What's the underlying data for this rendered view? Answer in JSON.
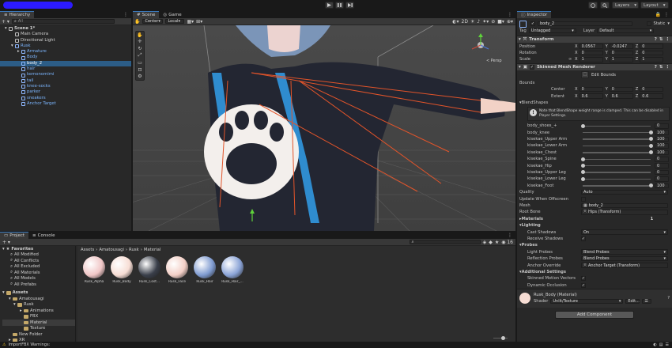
{
  "toolbar": {
    "layers_label": "Layers",
    "layout_label": "Layout"
  },
  "hierarchy": {
    "tab_label": "Hierarchy",
    "search_placeholder": "All",
    "items": [
      {
        "label": "Scene 1*",
        "selected": false
      },
      {
        "label": "Main Camera",
        "selected": false
      },
      {
        "label": "Directional Light",
        "selected": false
      },
      {
        "label": "Rusk",
        "selected": false
      },
      {
        "label": "Armature",
        "selected": false
      },
      {
        "label": "Body",
        "selected": false
      },
      {
        "label": "body_2",
        "selected": true
      },
      {
        "label": "hair",
        "selected": false
      },
      {
        "label": "kemonomimi",
        "selected": false
      },
      {
        "label": "tail",
        "selected": false
      },
      {
        "label": "knee-socks",
        "selected": false
      },
      {
        "label": "parker",
        "selected": false
      },
      {
        "label": "sneakers",
        "selected": false
      },
      {
        "label": "Anchor Target",
        "selected": false
      }
    ]
  },
  "scene": {
    "tabs": [
      {
        "label": "Scene"
      },
      {
        "label": "Game"
      }
    ],
    "center_label": "Center",
    "local_label": "Local",
    "persp_label": "< Persp"
  },
  "inspector": {
    "tab_label": "Inspector",
    "object_name": "body_2",
    "static_label": "Static",
    "tag_label": "Tag",
    "tag_value": "Untagged",
    "layer_label": "Layer",
    "layer_value": "Default",
    "transform": {
      "title": "Transform",
      "position_label": "Position",
      "rotation_label": "Rotation",
      "scale_label": "Scale",
      "position": {
        "x": "0.0567",
        "y": "-0.0247",
        "z": "0"
      },
      "rotation": {
        "x": "0",
        "y": "0",
        "z": "0"
      },
      "scale": {
        "x": "1",
        "y": "1",
        "z": "1"
      }
    },
    "smr": {
      "title": "Skinned Mesh Renderer",
      "edit_bounds": "Edit Bounds",
      "bounds_label": "Bounds",
      "center_label": "Center",
      "extent_label": "Extent",
      "center": {
        "x": "0",
        "y": "0",
        "z": "0"
      },
      "extent": {
        "x": "0.6",
        "y": "0.6",
        "z": "0.6"
      },
      "blendshapes_label": "BlendShapes",
      "note": "Note that BlendShape weight range is clamped. This can be disabled in Player Settings.",
      "blendshapes": [
        {
          "name": "body_shoes_+",
          "value": "0",
          "fraction": 0.0
        },
        {
          "name": "body_knee",
          "value": "100",
          "fraction": 1.0
        },
        {
          "name": "kisekae_Upper Arm",
          "value": "100",
          "fraction": 1.0
        },
        {
          "name": "kisekae_Lower Arm",
          "value": "100",
          "fraction": 1.0
        },
        {
          "name": "kisekae_Chest",
          "value": "100",
          "fraction": 1.0
        },
        {
          "name": "kisekae_Spine",
          "value": "0",
          "fraction": 0.0
        },
        {
          "name": "kisekae_Hip",
          "value": "0",
          "fraction": 0.0
        },
        {
          "name": "kisekae_Upper Leg",
          "value": "0",
          "fraction": 0.0
        },
        {
          "name": "kisekae_Lower Leg",
          "value": "0",
          "fraction": 0.0
        },
        {
          "name": "kisekae_Foot",
          "value": "100",
          "fraction": 1.0
        }
      ],
      "quality_label": "Quality",
      "quality_value": "Auto",
      "update_offscreen_label": "Update When Offscreen",
      "mesh_label": "Mesh",
      "mesh_value": "body_2",
      "root_bone_label": "Root Bone",
      "root_bone_value": "Hips (Transform)",
      "materials_label": "Materials",
      "materials_count": "1",
      "lighting_label": "Lighting",
      "cast_shadows_label": "Cast Shadows",
      "cast_shadows_value": "On",
      "receive_shadows_label": "Receive Shadows",
      "probes_label": "Probes",
      "light_probes_label": "Light Probes",
      "light_probes_value": "Blend Probes",
      "reflection_probes_label": "Reflection Probes",
      "reflection_probes_value": "Blend Probes",
      "anchor_override_label": "Anchor Override",
      "anchor_override_value": "Anchor Target (Transform)",
      "additional_label": "Additional Settings",
      "skinned_motion_label": "Skinned Motion Vectors",
      "dynamic_occlusion_label": "Dynamic Occlusion"
    },
    "material": {
      "name": "Rusk_Body (Material)",
      "shader_label": "Shader",
      "shader_value": "Unlit/Texture",
      "edit_label": "Edit..."
    },
    "add_component": "Add Component"
  },
  "project": {
    "tabs": [
      {
        "label": "Project"
      },
      {
        "label": "Console"
      }
    ],
    "breadcrumb": [
      "Assets",
      "Amatousagi",
      "Rusk",
      "Material"
    ],
    "favorites_label": "Favorites",
    "favorites": [
      "All Modified",
      "All Conflicts",
      "All Excluded",
      "All Materials",
      "All Models",
      "All Prefabs"
    ],
    "assets_label": "Assets",
    "tree": [
      "Amatousagi",
      "Rusk",
      "Animations",
      "FBX",
      "Material",
      "Texture",
      "New Folder",
      "XR"
    ],
    "assets": [
      {
        "label": "Rusk_Alpha",
        "color": "#f0c6c6"
      },
      {
        "label": "Rusk_Body",
        "color": "#f7ddd4"
      },
      {
        "label": "Rusk_Cost...",
        "color": "#3a3f4a"
      },
      {
        "label": "Rusk_Face",
        "color": "#f3cfc6"
      },
      {
        "label": "Rusk_Hair",
        "color": "#7f9bd0"
      },
      {
        "label": "Rusk_Hair_...",
        "color": "#8aa3d6"
      }
    ]
  },
  "status": {
    "warning": "ImportFBX Warnings:"
  }
}
